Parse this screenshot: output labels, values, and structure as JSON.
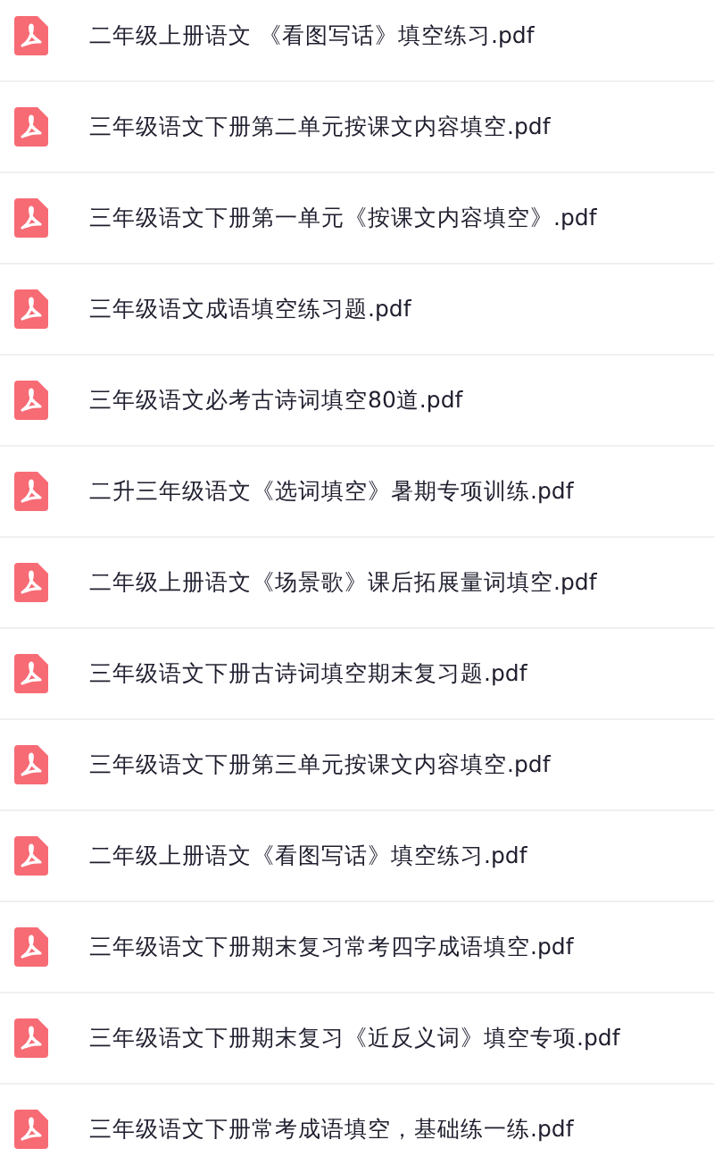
{
  "files": [
    {
      "name": "二年级上册语文 《看图写话》填空练习.pdf"
    },
    {
      "name": "三年级语文下册第二单元按课文内容填空.pdf"
    },
    {
      "name": "三年级语文下册第一单元《按课文内容填空》.pdf"
    },
    {
      "name": "三年级语文成语填空练习题.pdf"
    },
    {
      "name": "三年级语文必考古诗词填空80道.pdf"
    },
    {
      "name": "二升三年级语文《选词填空》暑期专项训练.pdf"
    },
    {
      "name": "二年级上册语文《场景歌》课后拓展量词填空.pdf"
    },
    {
      "name": "三年级语文下册古诗词填空期末复习题.pdf"
    },
    {
      "name": "三年级语文下册第三单元按课文内容填空.pdf"
    },
    {
      "name": "二年级上册语文《看图写话》填空练习.pdf"
    },
    {
      "name": "三年级语文下册期末复习常考四字成语填空.pdf"
    },
    {
      "name": "三年级语文下册期末复习《近反义词》填空专项.pdf"
    },
    {
      "name": "三年级语文下册常考成语填空，基础练一练.pdf"
    }
  ]
}
